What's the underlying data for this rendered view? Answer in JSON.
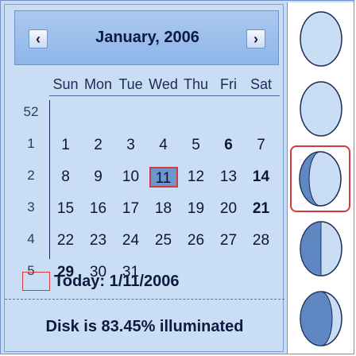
{
  "calendar": {
    "month_title": "January, 2006",
    "prev_icon": "‹",
    "next_icon": "›",
    "weekdays": [
      "Sun",
      "Mon",
      "Tue",
      "Wed",
      "Thu",
      "Fri",
      "Sat"
    ],
    "weeks": [
      {
        "number": "52",
        "days": [
          "",
          "",
          "",
          "",
          "",
          "",
          ""
        ]
      },
      {
        "number": "1",
        "days": [
          "1",
          "2",
          "3",
          "4",
          "5",
          "6",
          "7"
        ]
      },
      {
        "number": "2",
        "days": [
          "8",
          "9",
          "10",
          "11",
          "12",
          "13",
          "14"
        ]
      },
      {
        "number": "3",
        "days": [
          "15",
          "16",
          "17",
          "18",
          "19",
          "20",
          "21"
        ]
      },
      {
        "number": "4",
        "days": [
          "22",
          "23",
          "24",
          "25",
          "26",
          "27",
          "28"
        ]
      },
      {
        "number": "5",
        "days": [
          "29",
          "30",
          "31",
          "",
          "",
          "",
          ""
        ]
      }
    ],
    "selected_day": "11",
    "bold_days": [
      "6",
      "14",
      "21",
      "29"
    ],
    "today_label": "Today: 1/11/2006"
  },
  "status": {
    "text": "Disk is 83.45% illuminated"
  },
  "moon_phases": {
    "selected_index": 2,
    "icons": [
      "moon-phase-icon",
      "moon-phase-icon",
      "moon-phase-icon",
      "moon-phase-icon",
      "moon-phase-icon"
    ]
  },
  "colors": {
    "accent_red": "#d13b3b",
    "header_blue": "#8fb6e8",
    "panel_blue": "#c9def5",
    "selected_fill": "#6d95cf"
  }
}
